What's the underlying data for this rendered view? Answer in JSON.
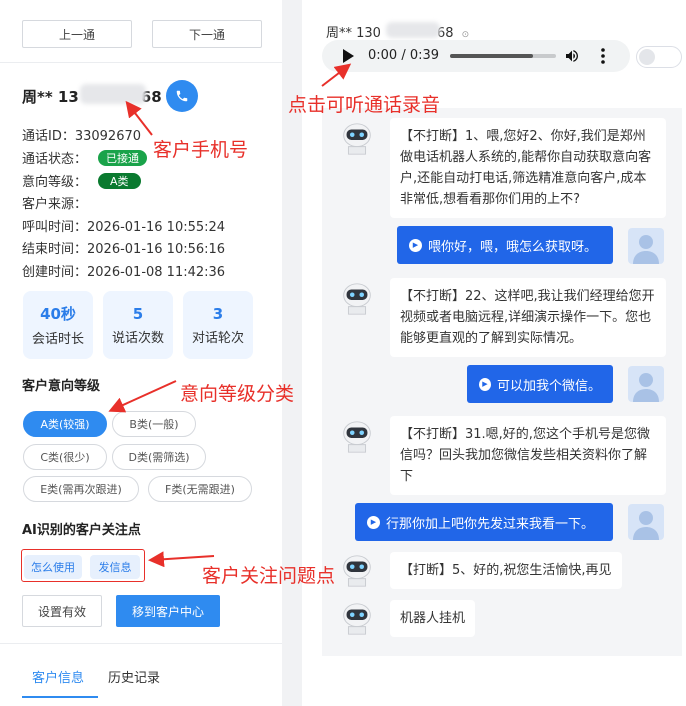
{
  "nav": {
    "prev_label": "上一通",
    "next_label": "下一通"
  },
  "customer": {
    "name_prefix": "周** 13",
    "name_suffix": "68",
    "phone_icon": "phone-icon"
  },
  "info": {
    "call_id": "通话ID：33092670",
    "status_label": "通话状态：",
    "status_tag": "已接通",
    "intent_label": "意向等级：",
    "intent_tag": "A类",
    "source": "客户来源：",
    "call_time": "呼叫时间：2026-01-16 10:55:24",
    "end_time": "结束时间：2026-01-16 10:56:16",
    "create_time": "创建时间：2026-01-08 11:42:36"
  },
  "stats": [
    {
      "value": "40秒",
      "label": "会话时长"
    },
    {
      "value": "5",
      "label": "说话次数"
    },
    {
      "value": "3",
      "label": "对话轮次"
    }
  ],
  "intent_section": {
    "title": "客户意向等级",
    "options": [
      "A类(较强)",
      "B类(一般)",
      "C类(很少)",
      "D类(需筛选)",
      "E类(需再次跟进)",
      "F类(无需跟进)"
    ],
    "selected": "A类(较强)"
  },
  "focus_section": {
    "title": "AI识别的客户关注点",
    "chips": [
      "怎么使用",
      "发信息"
    ]
  },
  "actions": {
    "set_valid": "设置有效",
    "move_to_center": "移到客户中心"
  },
  "tabs": [
    "客户信息",
    "历史记录"
  ],
  "right": {
    "header_prefix": "周** 130",
    "header_suffix": "68",
    "audio": {
      "time": "0:00 / 0:39",
      "progress": 0.0,
      "icons": [
        "play-icon",
        "volume-icon",
        "more-icon"
      ]
    }
  },
  "messages": [
    {
      "from": "robot",
      "text": "【不打断】1、喂,您好2、你好,我们是郑州做电话机器人系统的,能帮你自动获取意向客户,还能自动打电话,筛选精准意向客户,成本非常低,想看看那你们用的上不?"
    },
    {
      "from": "user",
      "text": "喂你好，喂，哦怎么获取呀。"
    },
    {
      "from": "robot",
      "text": "【不打断】22、这样吧,我让我们经理给您开视频或者电脑远程,详细演示操作一下。您也能够更直观的了解到实际情况。"
    },
    {
      "from": "user",
      "text": "可以加我个微信。"
    },
    {
      "from": "robot",
      "text": "【不打断】31.嗯,好的,您这个手机号是您微信吗？回头我加您微信发些相关资料你了解下"
    },
    {
      "from": "user",
      "text": "行那你加上吧你先发过来我看一下。"
    },
    {
      "from": "robot",
      "text": "【打断】5、好的,祝您生活愉快,再见"
    },
    {
      "from": "robot",
      "text": "机器人挂机"
    }
  ],
  "annotations": {
    "customer_phone": "客户手机号",
    "click_recording": "点击可听通话录音",
    "intent_classification": "意向等级分类",
    "concern_points": "客户关注问题点"
  },
  "colors": {
    "accent": "#2f8bf0",
    "green_tag": "#1aa34a",
    "dark_green_tag": "#0a7a2f",
    "user_bubble": "#2166e8",
    "annotation": "#e8302a"
  }
}
